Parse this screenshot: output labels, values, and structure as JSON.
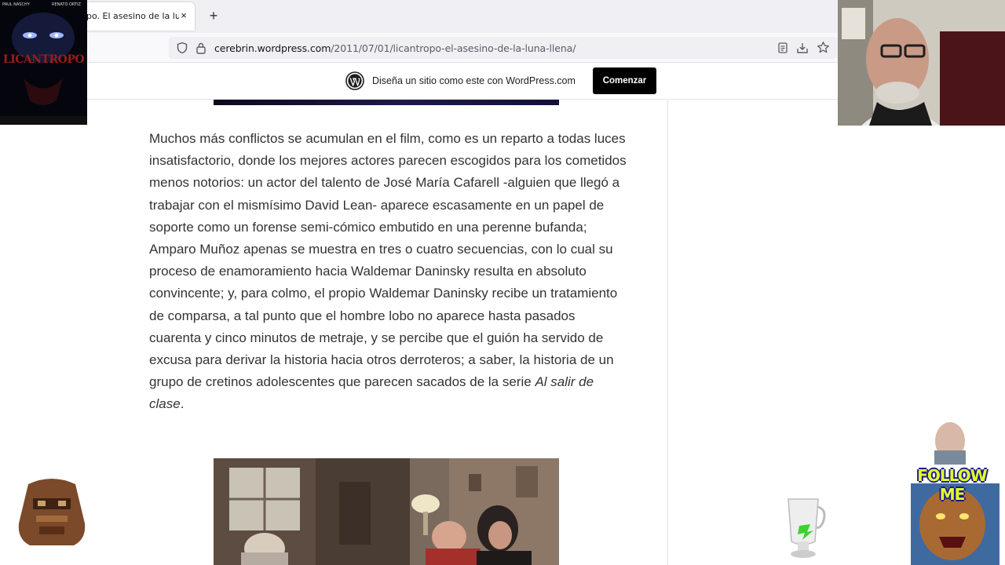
{
  "browser": {
    "tab_title": "po. El asesino de la luna",
    "tab_close": "×",
    "new_tab": "+",
    "url_host": "cerebrin.wordpress.com",
    "url_path": "/2011/07/01/licantropo-el-asesino-de-la-luna-llena/"
  },
  "wp_banner": {
    "text": "Diseña un sitio como este con WordPress.com",
    "button_label": "Comenzar"
  },
  "article": {
    "paragraph_main": "Muchos más conflictos se acumulan en el film, como es un reparto a todas luces insatisfactorio, donde los mejores actores parecen escogidos para los cometidos menos notorios: un actor del talento de José María Cafarell -alguien que llegó a trabajar con el mismísimo David Lean- aparece escasamente en un papel de soporte como un forense semi-cómico embutido en una perenne bufanda; Amparo Muñoz apenas se muestra en tres o cuatro secuencias, con lo cual su proceso de enamoramiento hacia Waldemar Daninsky resulta en absoluto convincente; y, para colmo, el propio Waldemar Daninsky recibe un tratamiento de comparsa, a tal punto que el hombre lobo no aparece hasta pasados cuarenta y cinco minutos de metraje, y se percibe que el guión ha servido de excusa para derivar la historia hacia otros derroteros; a saber, la historia de un grupo de cretinos adolescentes que parecen sacados de la serie ",
    "series_title": "Al salir de clase",
    "period": "."
  },
  "overlays": {
    "poster_title": "LICANTROPO",
    "poster_actor_left": "PAUL NASCHY",
    "poster_actor_right": "RENATO ORTIZ",
    "follow_text": "FOLLOW ME"
  },
  "colors": {
    "wp_button_bg": "#000000",
    "article_text": "#333333",
    "tab_strip_bg": "#f0f0f4"
  }
}
